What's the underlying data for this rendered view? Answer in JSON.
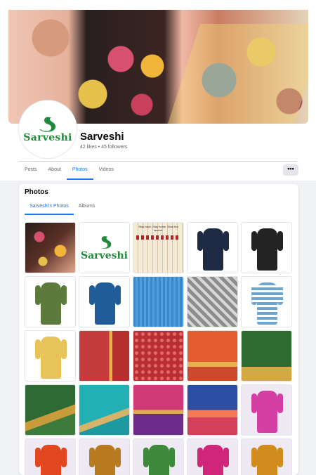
{
  "page": {
    "name": "Sarveshi",
    "stats": "42 likes • 45 followers",
    "avatar_logo_text": "Sarveshi"
  },
  "tabs": [
    {
      "label": "Posts"
    },
    {
      "label": "About"
    },
    {
      "label": "Photos"
    },
    {
      "label": "Videos"
    }
  ],
  "more_button_label": "•••",
  "photos_section": {
    "title": "Photos",
    "subtabs": [
      {
        "label": "Sarveshi's Photos"
      },
      {
        "label": "Albums"
      }
    ],
    "grid_logo_text": "Sarveshi",
    "matches_caption": "Stay back. Stay home. Slow the spread."
  },
  "colors": {
    "accent": "#1877f2",
    "brand_green": "#1f8a3a",
    "background": "#f0f2f5"
  }
}
